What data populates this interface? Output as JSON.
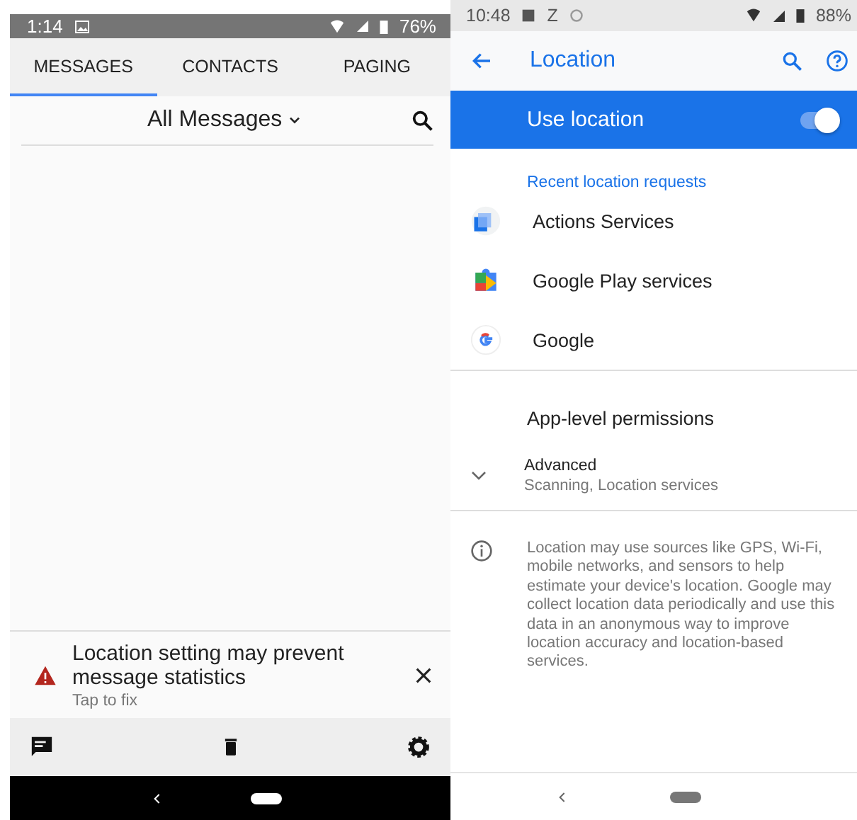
{
  "left_phone": {
    "status_bar": {
      "time": "1:14",
      "battery": "76%"
    },
    "tabs": [
      {
        "label": "MESSAGES",
        "selected": true
      },
      {
        "label": "CONTACTS",
        "selected": false
      },
      {
        "label": "PAGING",
        "selected": false
      }
    ],
    "filter": {
      "label": "All Messages"
    },
    "banner": {
      "title": "Location setting may prevent message statistics",
      "subtitle": "Tap to fix"
    }
  },
  "right_phone": {
    "status_bar": {
      "time": "10:48",
      "letter": "Z",
      "battery": "88%"
    },
    "app_bar": {
      "title": "Location"
    },
    "master_switch": {
      "label": "Use location",
      "on": true
    },
    "section_header": "Recent location requests",
    "recent_apps": [
      {
        "kind": "actions",
        "name": "Actions Services"
      },
      {
        "kind": "play",
        "name": "Google Play services"
      },
      {
        "kind": "google",
        "name": "Google"
      }
    ],
    "app_level": "App-level permissions",
    "advanced": {
      "title": "Advanced",
      "summary": "Scanning, Location services",
      "expanded": false
    },
    "info": "Location may use sources like GPS, Wi-Fi, mobile networks, and sensors to help estimate your device's location. Google may collect location data periodically and use this data in an anonymous way to improve location accuracy and location-based services."
  }
}
